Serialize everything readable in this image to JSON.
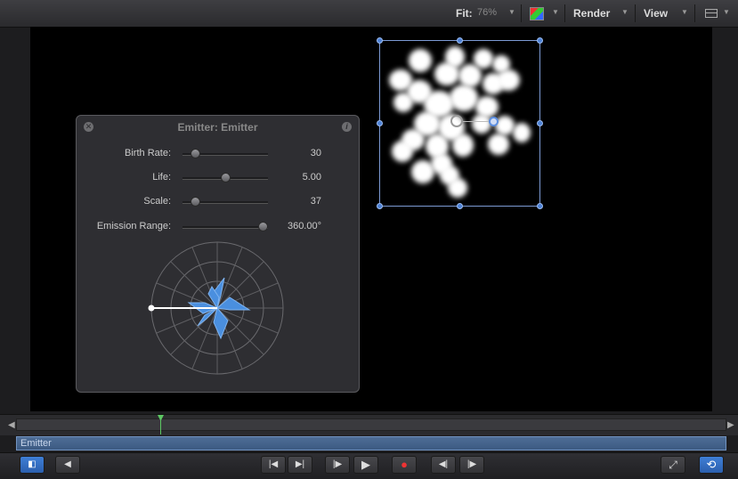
{
  "toolbar": {
    "fit_label": "Fit:",
    "fit_value": "76%",
    "render_label": "Render",
    "view_label": "View"
  },
  "hud": {
    "title": "Emitter: Emitter",
    "params": [
      {
        "label": "Birth Rate:",
        "value": "30",
        "slider_fraction": 0.1
      },
      {
        "label": "Life:",
        "value": "5.00",
        "slider_fraction": 0.5
      },
      {
        "label": "Scale:",
        "value": "37",
        "slider_fraction": 0.1
      },
      {
        "label": "Emission Range:",
        "value": "360.00°",
        "slider_fraction": 1.0
      }
    ]
  },
  "timeline": {
    "track_name": "Emitter"
  },
  "colors": {
    "accent": "#3f7fd6",
    "playhead": "#5dc763",
    "selection": "#4d82d6",
    "track": "#4e6d96"
  },
  "icons": [
    "color-channels-icon",
    "layout-icon",
    "close-icon",
    "info-icon",
    "play-icon",
    "record-icon",
    "loop-icon",
    "fullscreen-icon"
  ]
}
